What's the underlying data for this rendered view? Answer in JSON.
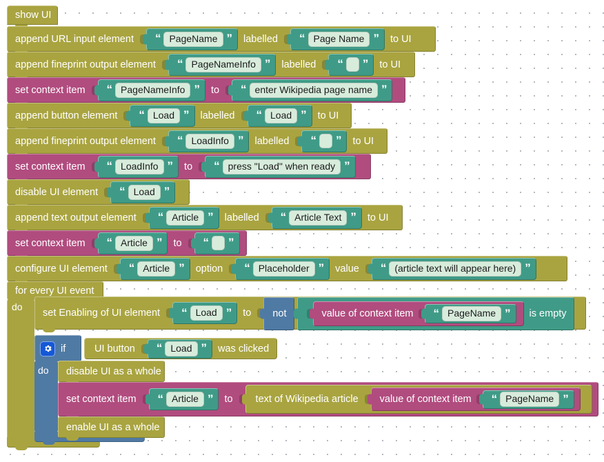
{
  "workspace": {
    "title": "Blockly UI script workspace",
    "colors": {
      "ui_block": "#a9a440",
      "context_block": "#b14c7f",
      "logic_block": "#4f7aa4",
      "text_block": "#3f9b87",
      "field_bg": "#d8ecdc",
      "gear_bg": "#1558d6",
      "canvas_bg": "#ffffff",
      "grid_dot": "#9aa0a6"
    }
  },
  "blocks": {
    "show_ui": {
      "label": "show UI"
    },
    "append_url": {
      "label": "append URL input element",
      "name_value": "PageName",
      "labelled_word": "labelled",
      "label_value": "Page Name",
      "to_ui": "to UI"
    },
    "append_fineprint_1": {
      "label": "append fineprint output element",
      "name_value": "PageNameInfo",
      "labelled_word": "labelled",
      "label_value": "",
      "to_ui": "to UI"
    },
    "set_context_1": {
      "label": "set context item",
      "key": "PageNameInfo",
      "to_word": "to",
      "value": "enter Wikipedia page name"
    },
    "append_button": {
      "label": "append button element",
      "name_value": "Load",
      "labelled_word": "labelled",
      "label_value": "Load",
      "to_ui": "to UI"
    },
    "append_fineprint_2": {
      "label": "append fineprint output element",
      "name_value": "LoadInfo",
      "labelled_word": "labelled",
      "label_value": "",
      "to_ui": "to UI"
    },
    "set_context_2": {
      "label": "set context item",
      "key": "LoadInfo",
      "to_word": "to",
      "value": "press \"Load\" when ready"
    },
    "disable_ui_element": {
      "label": "disable UI element",
      "name_value": "Load"
    },
    "append_text_output": {
      "label": "append text output element",
      "name_value": "Article",
      "labelled_word": "labelled",
      "label_value": "Article Text",
      "to_ui": "to UI"
    },
    "set_context_3": {
      "label": "set context item",
      "key": "Article",
      "to_word": "to",
      "value": ""
    },
    "configure_ui_element": {
      "label": "configure UI element",
      "name_value": "Article",
      "option_word": "option",
      "option_value": "Placeholder",
      "value_word": "value",
      "value_value": "(article text will appear here)"
    },
    "for_every_ui_event": {
      "label": "for every UI event",
      "do_label": "do"
    },
    "set_enabling": {
      "label": "set Enabling of UI element",
      "name_value": "Load",
      "to_word": "to",
      "not_word": "not",
      "value_of_context_item": "value of context item",
      "context_key": "PageName",
      "is_empty": "is empty"
    },
    "if_block": {
      "gear_icon": "gear-icon",
      "if_word": "if",
      "do_word": "do",
      "condition": {
        "ui_button_word": "UI button",
        "button_name": "Load",
        "was_clicked": "was clicked"
      }
    },
    "disable_ui_whole": {
      "label": "disable UI as a whole"
    },
    "set_context_4": {
      "label": "set context item",
      "key": "Article",
      "to_word": "to",
      "wiki_label": "text of Wikipedia article",
      "value_of_context_item": "value of context item",
      "context_key": "PageName"
    },
    "enable_ui_whole": {
      "label": "enable UI as a whole"
    }
  }
}
